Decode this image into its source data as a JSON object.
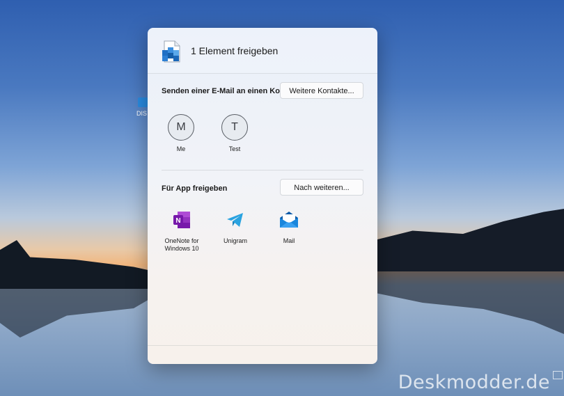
{
  "dialog": {
    "title": "1 Element freigeben",
    "email_section": {
      "label": "Senden einer E-Mail an einen Kontakt",
      "more_contacts_button": "Weitere Kontakte..."
    },
    "contacts": [
      {
        "initial": "M",
        "name": "Me"
      },
      {
        "initial": "T",
        "name": "Test"
      }
    ],
    "app_section": {
      "label": "Für App freigeben",
      "more_apps_button": "Nach weiteren..."
    },
    "apps": [
      {
        "name_line1": "OneNote for",
        "name_line2": "Windows 10",
        "icon": "onenote-icon",
        "color": "#7719aa"
      },
      {
        "name_line1": "Unigram",
        "name_line2": "",
        "icon": "telegram-icon",
        "color": "#2aa3e0"
      },
      {
        "name_line1": "Mail",
        "name_line2": "",
        "icon": "mail-icon",
        "color": "#0b6cc4"
      }
    ]
  },
  "desktop": {
    "icon_label": "DIS",
    "watermark": "Deskmodder.de"
  }
}
